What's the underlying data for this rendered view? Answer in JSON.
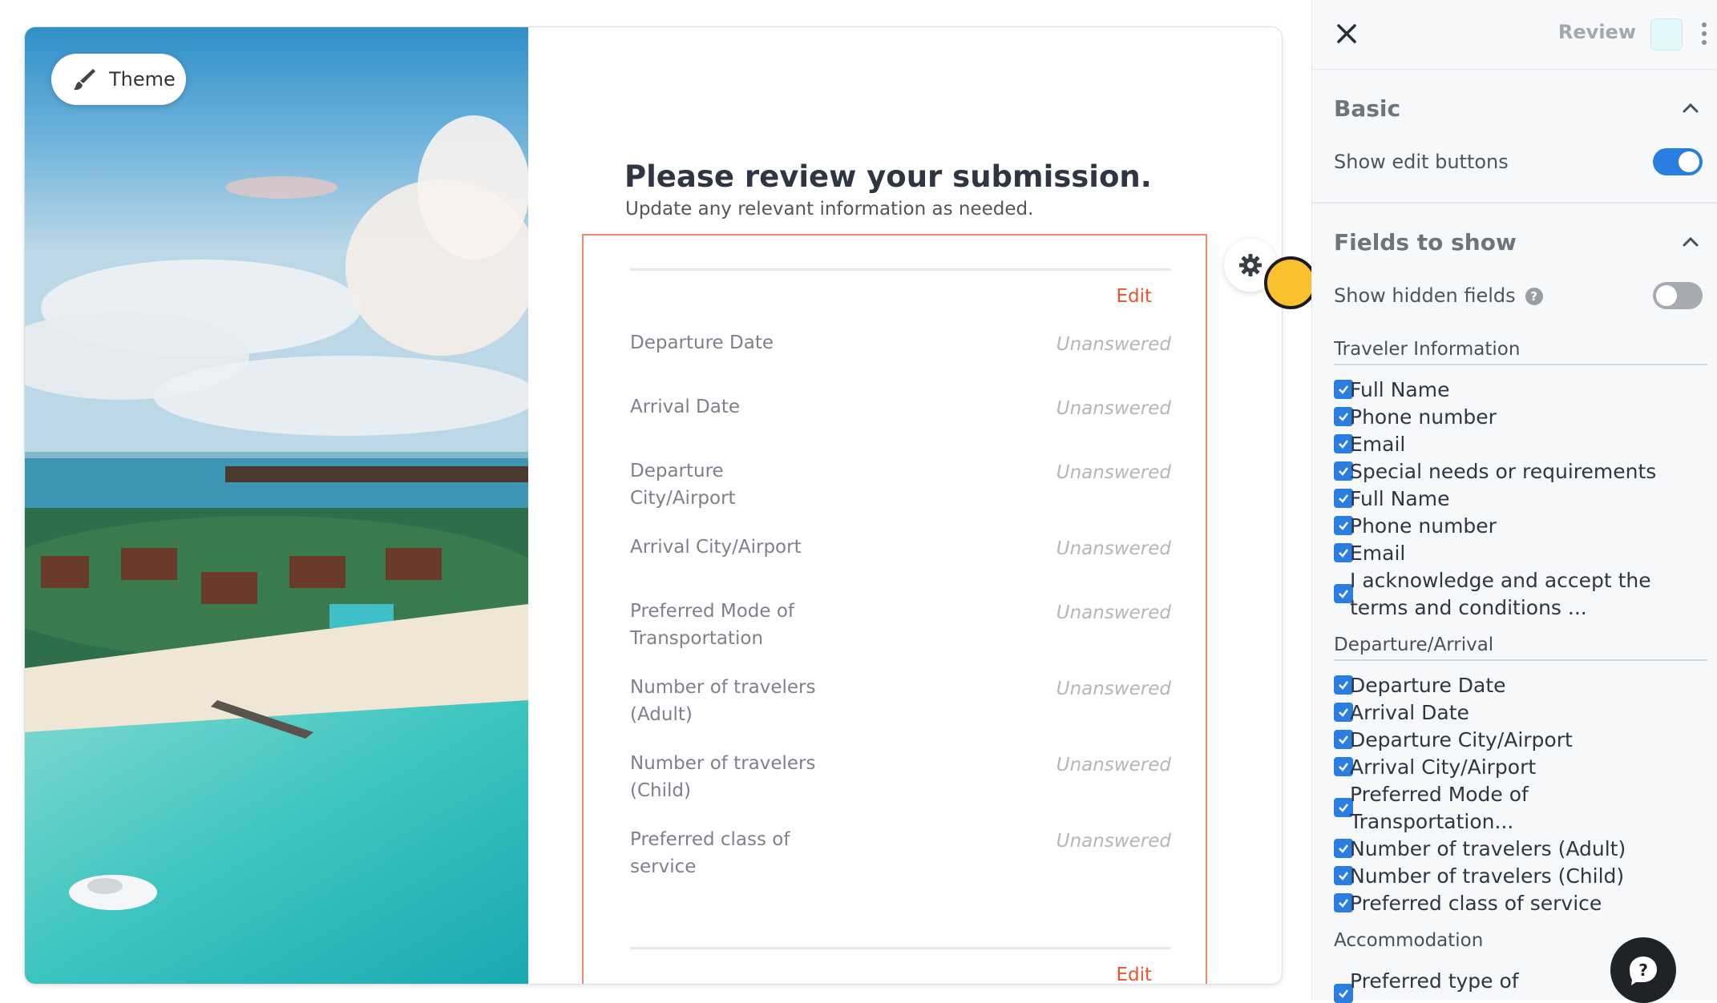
{
  "preview": {
    "theme_button_label": "Theme",
    "heading": "Please review your submission.",
    "subheading": "Update any relevant information as needed.",
    "edit_label": "Edit",
    "fields": [
      {
        "label": "Departure Date",
        "value": "Unanswered"
      },
      {
        "label": "Arrival Date",
        "value": "Unanswered"
      },
      {
        "label": "Departure City/Airport",
        "value": "Unanswered"
      },
      {
        "label": "Arrival City/Airport",
        "value": "Unanswered"
      },
      {
        "label": "Preferred Mode of Transportation",
        "value": "Unanswered"
      },
      {
        "label": "Number of travelers (Adult)",
        "value": "Unanswered"
      },
      {
        "label": "Number of travelers (Child)",
        "value": "Unanswered"
      },
      {
        "label": "Preferred class of service",
        "value": "Unanswered"
      }
    ]
  },
  "panel": {
    "title": "Review",
    "accent_color": "#e3f8fa",
    "basic": {
      "heading": "Basic",
      "show_edit_buttons_label": "Show edit buttons",
      "show_edit_buttons_on": true
    },
    "fields_to_show": {
      "heading": "Fields to show",
      "show_hidden_fields_label": "Show hidden fields",
      "show_hidden_fields_on": false,
      "groups": [
        {
          "title": "Traveler Information",
          "items": [
            "Full Name",
            "Phone number",
            "Email",
            "Special needs or requirements",
            "Full Name",
            "Phone number",
            "Email",
            "I acknowledge and accept the terms and conditions ..."
          ]
        },
        {
          "title": "Departure/Arrival",
          "items": [
            "Departure Date",
            "Arrival Date",
            "Departure City/Airport",
            "Arrival City/Airport",
            "Preferred Mode of Transportation...",
            "Number of travelers (Adult)",
            "Number of travelers (Child)",
            "Preferred class of service"
          ]
        },
        {
          "title": "Accommodation",
          "items": [
            "Preferred type of"
          ]
        }
      ]
    }
  }
}
